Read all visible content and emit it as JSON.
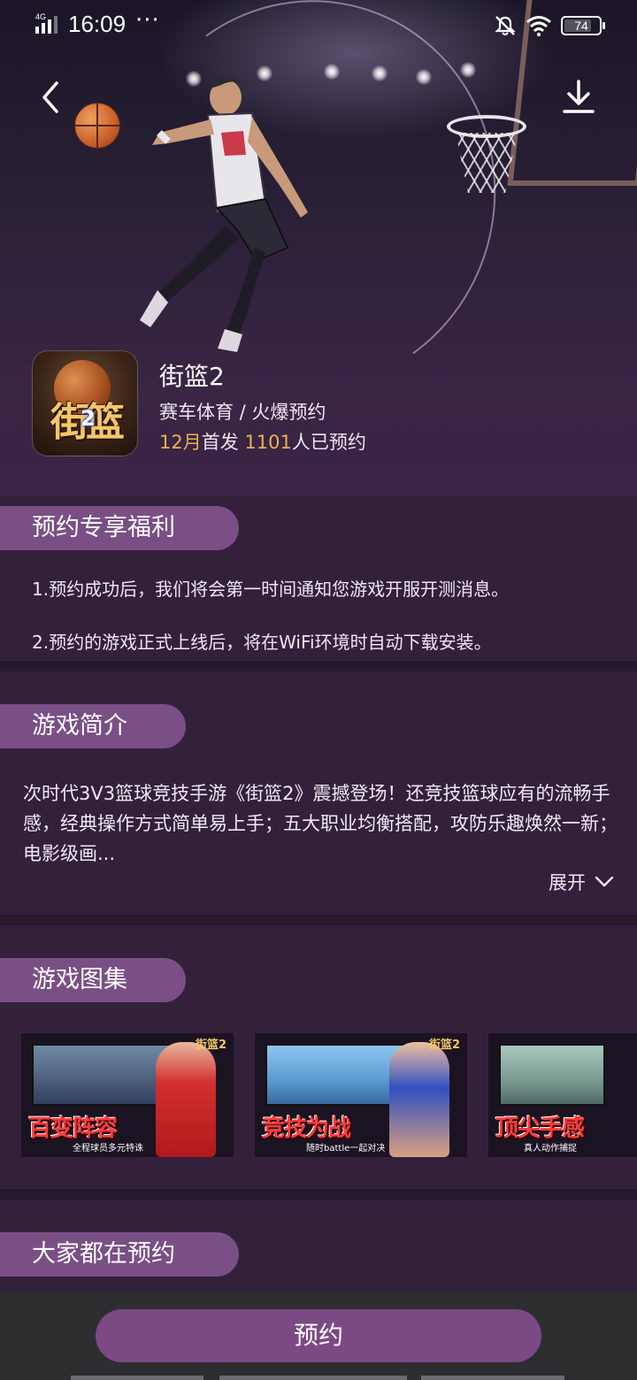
{
  "status_bar": {
    "network": "4G",
    "time": "16:09",
    "dots": "···",
    "battery": "74",
    "icons": [
      "signal-icon",
      "mute-icon",
      "wifi-icon",
      "battery-icon"
    ]
  },
  "hero": {
    "back_icon": "chevron-left-icon",
    "download_icon": "download-icon"
  },
  "app": {
    "name": "街篮2",
    "category": "赛车体育 / 火爆预约",
    "release_month": "12月",
    "release_suffix": "首发",
    "reservations_count": "1101",
    "reservations_suffix": "人已预约",
    "icon_text": "街篮",
    "icon_number": "2"
  },
  "benefits": {
    "title": "预约专享福利",
    "items": [
      "1.预约成功后，我们将会第一时间通知您游戏开服开测消息。",
      "2.预约的游戏正式上线后，将在WiFi环境时自动下载安装。"
    ]
  },
  "intro": {
    "title": "游戏简介",
    "text": "次时代3V3篮球竞技手游《街篮2》震撼登场！还竞技篮球应有的流畅手感，经典操作方式简单易上手；五大职业均衡搭配，攻防乐趣焕然一新；电影级画...",
    "expand_label": "展开"
  },
  "gallery": {
    "title": "游戏图集",
    "shots": [
      {
        "caption": "百变阵容",
        "sub": "全程球员多元特诛",
        "logo": "街篮2"
      },
      {
        "caption": "竞技为战",
        "sub": "随时battle一起对决",
        "logo": "街篮2"
      },
      {
        "caption": "顶尖手感",
        "sub": "真人动作捕捉",
        "logo": ""
      }
    ]
  },
  "popular": {
    "title": "大家都在预约"
  },
  "action": {
    "reserve_label": "预约"
  },
  "colors": {
    "background": "#33213c",
    "pill": "#7a4f86",
    "accent": "#e9b04a",
    "button": "#7b4a85",
    "bottom_bar": "#2e2e31"
  }
}
